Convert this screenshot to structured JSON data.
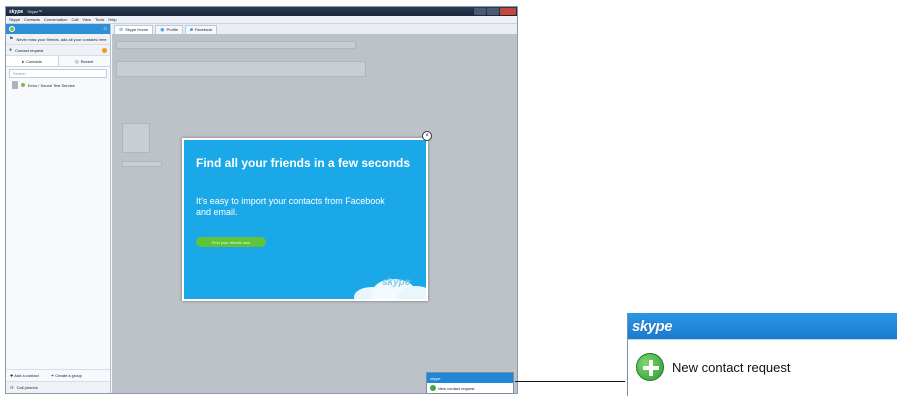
{
  "window": {
    "brand": "skype",
    "title": "Skype™",
    "menu": [
      "Skype",
      "Contacts",
      "Conversation",
      "Call",
      "View",
      "Tools",
      "Help"
    ]
  },
  "sidebar": {
    "import_prompt": "Never miss your friends, add all your contacts here",
    "contact_request": "Contact request",
    "tabs": [
      "Contacts",
      "Recent"
    ],
    "search_placeholder": "Search",
    "contacts": [
      {
        "name": "Echo / Sound Test Service"
      }
    ],
    "add_contact": "Add a contact",
    "create_group": "Create a group",
    "call_phones": "Call phones"
  },
  "main_tabs": [
    "Skype Home",
    "Profile",
    "Facebook"
  ],
  "modal": {
    "heading": "Find all your friends in a few seconds",
    "body": "It's easy to import your contacts from Facebook and email.",
    "cta": "Find your friends now",
    "brand": "skype"
  },
  "toast_small": {
    "brand": "skype",
    "text": "New contact request"
  },
  "toast_big": {
    "brand": "skype",
    "text": "New contact request"
  },
  "colors": {
    "accent": "#1ba8e8",
    "brand_blue": "#1e88d7",
    "online": "#78c43e",
    "cta_green": "#5fc43a"
  }
}
